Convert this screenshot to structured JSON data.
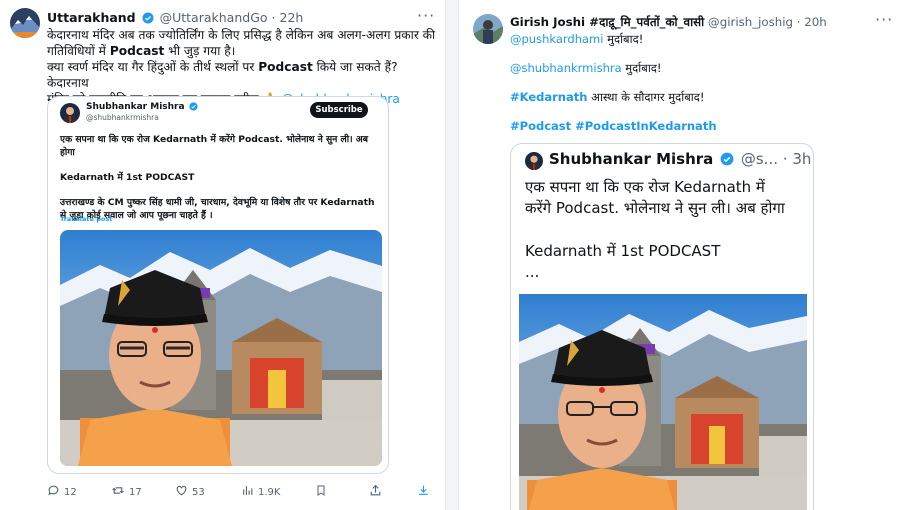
{
  "left_tweet": {
    "author_name": "Uttarakhand",
    "handle": "@UttarakhandGo",
    "separator": "·",
    "time": "22h",
    "more": "···",
    "line1": "केदारनाथ मंदिर अब तक ज्योतिर्लिंग के लिए प्रसिद्ध है लेकिन अब अलग-अलग प्रकार की",
    "line2_pre": "गतिविधियों में ",
    "line2_bold": "Podcast",
    "line2_post": " भी जुड़ गया है।",
    "line3_pre": "क्या स्वर्ण मंदिर या गैर हिंदुओं के तीर्थ स्थलों पर ",
    "line3_bold": "Podcast",
    "line3_post": " किये जा सकते हैं? केदारनाथ",
    "line4_pre": "मंदिर को राजनीति का अखाड़ा मत बनाइए प्लीज ",
    "line4_emoji": "🙏",
    "line4_mention": "@shubhankrmishra",
    "quote": {
      "author_name": "Shubhankar Mishra",
      "handle": "@shubhankrmishra",
      "subscribe": "Subscribe",
      "line1": "एक सपना था कि एक रोज Kedarnath में करेंगे Podcast. भोलेनाथ ने सुन ली। अब होगा",
      "line2": "Kedarnath में 1st PODCAST",
      "line3": "उत्तराखण्ड के CM पुष्कर सिंह धामी जी, चारधाम, देवभूमि या विशेष तौर पर Kedarnath",
      "line4": "से जुड़ा कोई सवाल जो आप पूछना चाहते हैं ।",
      "translate": "Translate post"
    },
    "actions": {
      "replies": "12",
      "reposts": "17",
      "likes": "53",
      "views": "1.9K"
    }
  },
  "right_tweet": {
    "author_name": "Girish Joshi #दाद़ू_मि_पर्वतों_को_वासी",
    "handle": "@girish_joshig",
    "separator": "·",
    "time": "20h",
    "more": "···",
    "line1_mention": "@pushkardhami",
    "line1_text": " मुर्दाबाद!",
    "line2_mention": "@shubhankrmishra",
    "line2_text": " मुर्दाबाद!",
    "line3_tag": "#Kedarnath",
    "line3_text": " आस्था के सौदागर मुर्दाबाद!",
    "line4_tags": "#Podcast #PodcastInKedarnath",
    "quote": {
      "author_name": "Shubhankar Mishra",
      "handle": "@s...",
      "separator": "·",
      "time": "3h",
      "line1": "एक सपना था कि एक रोज Kedarnath में",
      "line2": "करेंगे Podcast. भोलेनाथ ने सुन ली। अब होगा",
      "line3": "Kedarnath में 1st PODCAST",
      "line4": "..."
    }
  },
  "colors": {
    "link": "#1d9bf0",
    "verified": "#1d9bf0",
    "text": "#0f1419",
    "muted": "#536471"
  }
}
